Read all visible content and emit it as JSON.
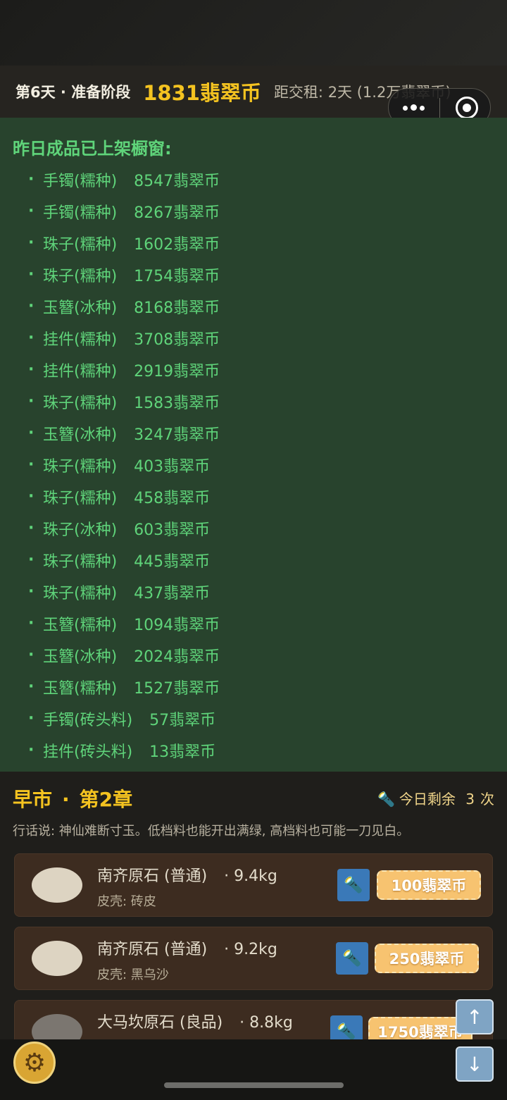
{
  "header": {
    "day_phase": "第6天 · 准备阶段",
    "coins": "1831翡翠币",
    "rent": "距交租: 2天 (1.2万翡翠币)"
  },
  "panel": {
    "title": "昨日成品已上架橱窗:",
    "items": [
      {
        "name": "手镯(糯种)",
        "price": "8547翡翠币"
      },
      {
        "name": "手镯(糯种)",
        "price": "8267翡翠币"
      },
      {
        "name": "珠子(糯种)",
        "price": "1602翡翠币"
      },
      {
        "name": "珠子(糯种)",
        "price": "1754翡翠币"
      },
      {
        "name": "玉簪(冰种)",
        "price": "8168翡翠币"
      },
      {
        "name": "挂件(糯种)",
        "price": "3708翡翠币"
      },
      {
        "name": "挂件(糯种)",
        "price": "2919翡翠币"
      },
      {
        "name": "珠子(糯种)",
        "price": "1583翡翠币"
      },
      {
        "name": "玉簪(冰种)",
        "price": "3247翡翠币"
      },
      {
        "name": "珠子(糯种)",
        "price": "403翡翠币"
      },
      {
        "name": "珠子(糯种)",
        "price": "458翡翠币"
      },
      {
        "name": "珠子(冰种)",
        "price": "603翡翠币"
      },
      {
        "name": "珠子(糯种)",
        "price": "445翡翠币"
      },
      {
        "name": "珠子(糯种)",
        "price": "437翡翠币"
      },
      {
        "name": "玉簪(糯种)",
        "price": "1094翡翠币"
      },
      {
        "name": "玉簪(冰种)",
        "price": "2024翡翠币"
      },
      {
        "name": "玉簪(糯种)",
        "price": "1527翡翠币"
      },
      {
        "name": "手镯(砖头料)",
        "price": "57翡翠币"
      },
      {
        "name": "挂件(砖头料)",
        "price": "13翡翠币"
      }
    ]
  },
  "market": {
    "title": "早市",
    "chapter": "第2章",
    "remaining_label": "今日剩余",
    "remaining_count": "3",
    "remaining_unit": "次",
    "hint": "行话说: 神仙难断寸玉。低档料也能开出满绿, 高档料也可能一刀见白。",
    "stones": [
      {
        "name": "南齐原石 (普通)",
        "weight": "· 9.4kg",
        "skin": "皮壳: 砖皮",
        "price": "100翡翠币",
        "shade": "light"
      },
      {
        "name": "南齐原石 (普通)",
        "weight": "· 9.2kg",
        "skin": "皮壳: 黑乌沙",
        "price": "250翡翠币",
        "shade": "light"
      },
      {
        "name": "大马坎原石 (良品)",
        "weight": "· 8.8kg",
        "skin": "",
        "price": "1750翡翠币",
        "shade": "gray"
      }
    ]
  },
  "icons": {
    "menu": "more-dots-icon",
    "close": "target-icon",
    "flashlight": "flashlight-icon",
    "settings": "gear-icon",
    "scroll_up": "arrow-up-icon",
    "scroll_down": "arrow-down-icon"
  },
  "colors": {
    "coins": "#f4c320",
    "panel_bg": "#28432d",
    "panel_text": "#5fd47a",
    "price_button": "#f7c370",
    "flash_button": "#3a79b8"
  }
}
